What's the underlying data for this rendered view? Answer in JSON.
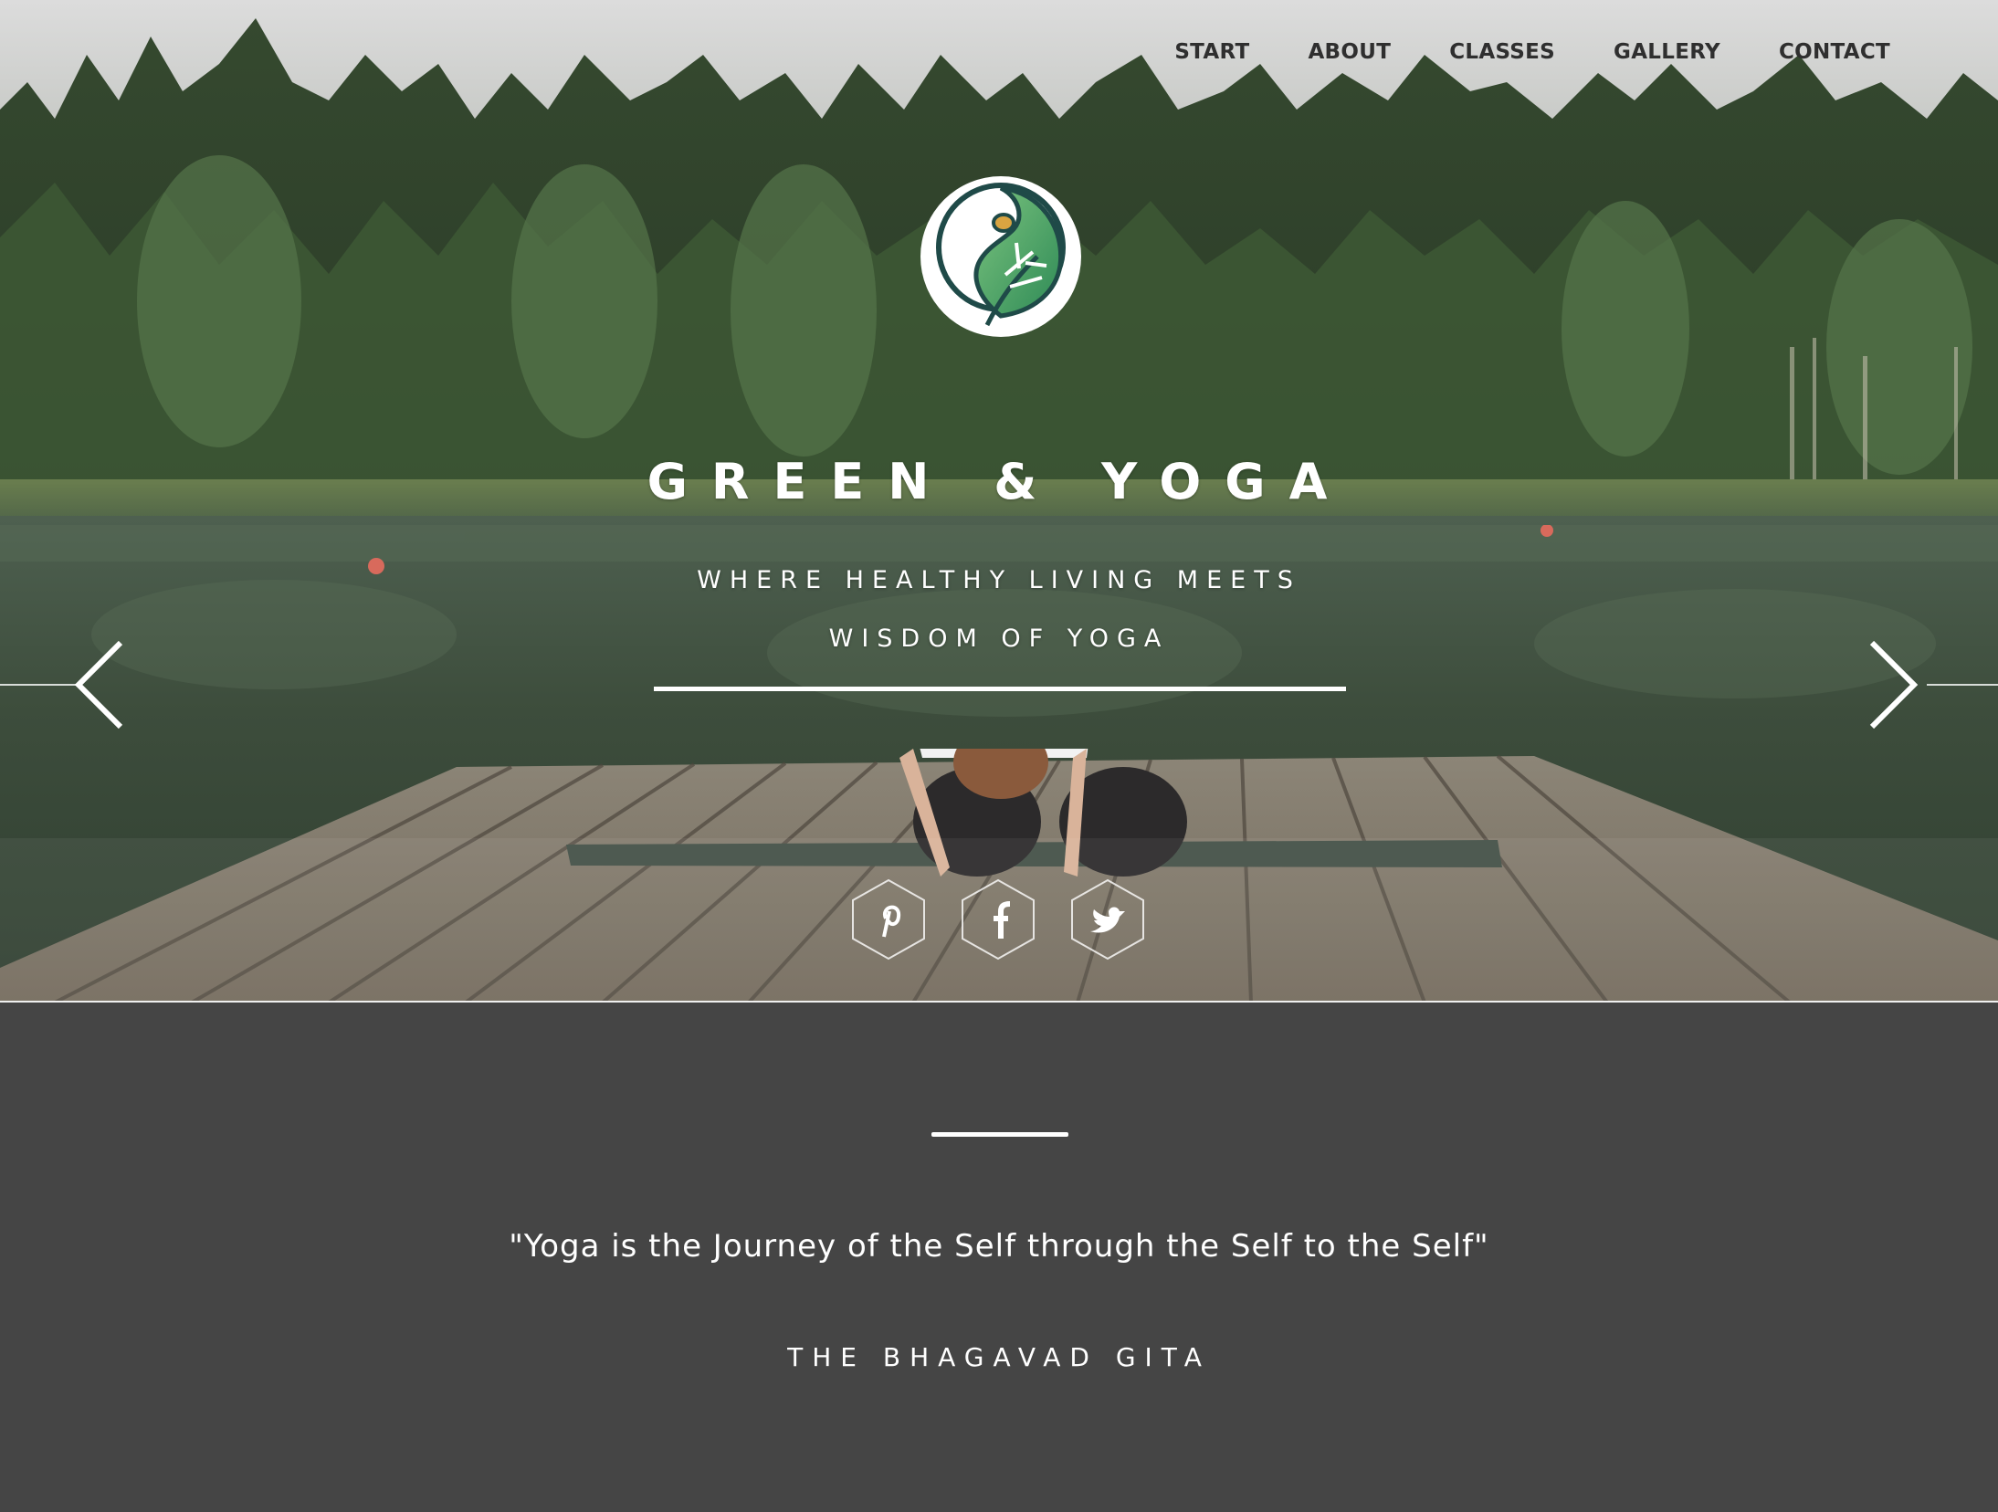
{
  "nav": {
    "items": [
      {
        "label": "START"
      },
      {
        "label": "ABOUT"
      },
      {
        "label": "CLASSES"
      },
      {
        "label": "GALLERY"
      },
      {
        "label": "CONTACT"
      }
    ]
  },
  "hero": {
    "title": "GREEN & YOGA",
    "tagline_line1": "WHERE HEALTHY LIVING MEETS",
    "tagline_line2": "WISDOM OF YOGA",
    "logo_icon": "leaf-yin-yang-icon",
    "prev_icon": "chevron-left-icon",
    "next_icon": "chevron-right-icon"
  },
  "socials": [
    {
      "name": "pinterest-icon"
    },
    {
      "name": "facebook-icon"
    },
    {
      "name": "twitter-icon"
    }
  ],
  "quote": {
    "text": "\"Yoga is the Journey of the Self through the Self to the Self\"",
    "author": "THE BHAGAVAD GITA"
  },
  "colors": {
    "nav_text": "#2f2f2f",
    "quote_background": "#454545",
    "logo_green": "#3a9a5a",
    "logo_dark": "#1f4a48",
    "logo_accent": "#d9a441"
  }
}
